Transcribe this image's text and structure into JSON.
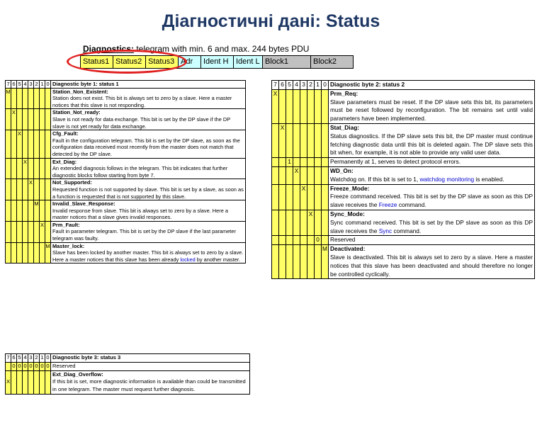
{
  "title": "Діагностичні дані: Status",
  "diagnostics": {
    "caption_bold": "Diagnostics:",
    "caption_rest": " telegram with min. 6 and max. 244 bytes PDU",
    "cells": [
      {
        "label": "Status1",
        "color": "#ffff66"
      },
      {
        "label": "Status2",
        "color": "#ffff66"
      },
      {
        "label": "Status3",
        "color": "#ffff66"
      },
      {
        "label": "Adr",
        "color": "#ccffff"
      },
      {
        "label": "Ident H",
        "color": "#ccffff"
      },
      {
        "label": "Ident L",
        "color": "#ccffff"
      },
      {
        "label": "Block1",
        "color": "#c0c0c0"
      },
      {
        "label": "Block2",
        "color": "#c0c0c0"
      }
    ],
    "highlight_color": "#e02020"
  },
  "bits": [
    "7",
    "6",
    "5",
    "4",
    "3",
    "2",
    "1",
    "0"
  ],
  "table1": {
    "header": "Diagnostic byte 1: status 1",
    "rows": [
      {
        "mark": "M",
        "pos": 7,
        "name": "Station_Non_Existent:",
        "text": "Station does not exist. This bit is always set to zero by a slave. Here a master notices that this slave is not responding."
      },
      {
        "mark": "X",
        "pos": 6,
        "name": "Station_Not_ready:",
        "text": "Slave is not ready for data exchange. This bit is set by the DP slave if the DP slave is not yet ready for data exchange."
      },
      {
        "mark": "X",
        "pos": 5,
        "name": "Cfg_Fault:",
        "text": "Fault in the configuration telegram. This bit is set by the DP slave, as soon as the configuration data received most recently from the master does not match that detected by the DP slave."
      },
      {
        "mark": "X",
        "pos": 4,
        "name": "Ext_Diag:",
        "text": "An extended diagnosis follows in the telegram. This bit indicates that further diagnostic blocks follow starting from byte 7."
      },
      {
        "mark": "X",
        "pos": 3,
        "name": "Not_Supported:",
        "text": "Requested function is not supported by slave. This bit is set by a slave, as soon as a function is requested that is not supported by this slave."
      },
      {
        "mark": "M",
        "pos": 2,
        "name": "Invalid_Slave_Response:",
        "text": "Invalid response from slave. This bit is always set to zero by a slave. Here a master notices that a slave gives invalid responses."
      },
      {
        "mark": "X",
        "pos": 1,
        "name": "Prm_Fault:",
        "text": "Fault in parameter telegram. This bit is set by the DP slave if the last parameter telegram was faulty."
      },
      {
        "mark": "M",
        "pos": 0,
        "name": "Master_lock:",
        "text": "Slave has been locked by another master. This bit is always set to zero by a slave. Here a master notices that this slave has been already ",
        "link": "locked",
        "after": " by another master."
      }
    ]
  },
  "table2": {
    "header": "Diagnostic byte 2: status 2",
    "rows": [
      {
        "mark": "X",
        "pos": 7,
        "name": "Prm_Req:",
        "text": "Slave parameters must be reset. If the DP slave sets this bit, its parameters must be reset followed by reconfiguration. The bit remains set until valid parameters have been implemented."
      },
      {
        "mark": "X",
        "pos": 6,
        "name": "Stat_Diag:",
        "text": "Status diagnostics. If the DP slave sets this bit, the DP master must continue fetching diagnostic data until this bit is deleted again. The DP slave sets this bit when, for example, it is not able to provide any valid user data."
      },
      {
        "mark": "1",
        "pos": 5,
        "name": "",
        "text": "Permanently at 1, serves to detect protocol errors."
      },
      {
        "mark": "X",
        "pos": 4,
        "name": "WD_On:",
        "text": "Watchdog on. If this bit is set to 1, ",
        "link": "watchdog monitoring",
        "after": " is enabled."
      },
      {
        "mark": "X",
        "pos": 3,
        "name": "Freeze_Mode:",
        "text": "Freeze command received. This bit is set by the DP slave as soon as this DP slave receives the ",
        "link": "Freeze",
        "after": " command."
      },
      {
        "mark": "X",
        "pos": 2,
        "name": "Sync_Mode:",
        "text": "Sync command received. This bit is set by the DP slave as soon as this DP slave receives the ",
        "link": "Sync",
        "after": " command."
      },
      {
        "mark": "0",
        "pos": 1,
        "name": "",
        "text": "Reserved"
      },
      {
        "mark": "M",
        "pos": 0,
        "name": "Deactivated:",
        "text": "Slave is deactivated. This bit is always set to zero by a slave. Here a master notices that this slave has been deactivated and should therefore no longer be controlled cyclically."
      }
    ]
  },
  "table3": {
    "header": "Diagnostic byte 3: status 3",
    "reserved_row": {
      "marks": [
        "0",
        "0",
        "0",
        "0",
        "0",
        "0",
        "0"
      ],
      "text": "Reserved"
    },
    "overflow_row": {
      "mark": "X",
      "name": "Ext_Diag_Overflow:",
      "text": "If this bit is set, more diagnostic information is available than could be transmitted in one telegram. The master must request further diagnosis."
    }
  }
}
